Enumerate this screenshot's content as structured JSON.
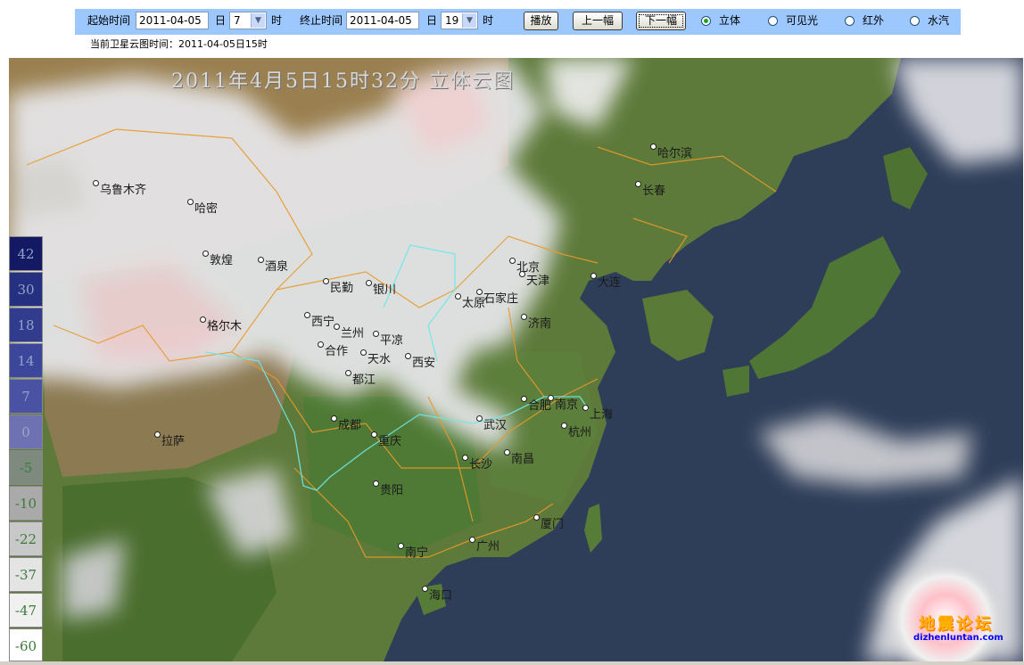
{
  "toolbar": {
    "start_label": "起始时间",
    "start_date": "2011-04-05",
    "start_day_unit": "日",
    "start_hour": "7",
    "start_hour_unit": "时",
    "end_label": "终止时间",
    "end_date": "2011-04-05",
    "end_day_unit": "日",
    "end_hour": "19",
    "end_hour_unit": "时",
    "play_button": "播放",
    "prev_button": "上一幅",
    "next_button": "下一幅",
    "modes": [
      {
        "label": "立体",
        "selected": true
      },
      {
        "label": "可见光",
        "selected": false
      },
      {
        "label": "红外",
        "selected": false
      },
      {
        "label": "水汽",
        "selected": false
      }
    ]
  },
  "current_time": "当前卫星云图时间：2011-04-05日15时",
  "map": {
    "title": "2011年4月5日15时32分  立体云图",
    "cities": [
      "乌鲁木齐",
      "哈密",
      "敦煌",
      "酒泉",
      "格尔木",
      "民勤",
      "银川",
      "西宁",
      "兰州",
      "合作",
      "平凉",
      "天水",
      "西安",
      "成都",
      "都江",
      "拉萨",
      "重庆",
      "贵阳",
      "太原",
      "石家庄",
      "北京",
      "天津",
      "大连",
      "济南",
      "合肥",
      "南京",
      "上海",
      "杭州",
      "武汉",
      "长沙",
      "南昌",
      "厦门",
      "广州",
      "南宁",
      "海口",
      "哈尔滨",
      "长春"
    ]
  },
  "legend": {
    "values": [
      "42",
      "30",
      "18",
      "14",
      "7",
      "0",
      "-5",
      "-10",
      "-22",
      "-37",
      "-47",
      "-60"
    ],
    "colors": [
      "#141964",
      "#263080",
      "#323c8e",
      "#3c469a",
      "#4a52a4",
      "#6e72b2",
      "#7f8a7f",
      "#aaaaaa",
      "#c8c8c8",
      "#e4e4e4",
      "#f0f0f0",
      "#ffffff"
    ]
  },
  "watermark": {
    "text": "地震论坛",
    "url": "dizhenluntan.com"
  }
}
